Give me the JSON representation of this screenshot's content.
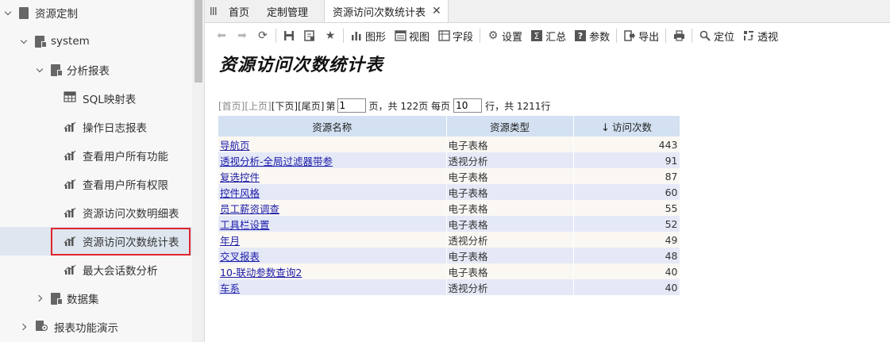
{
  "sidebar": {
    "items": [
      {
        "label": "资源定制"
      },
      {
        "label": "system"
      },
      {
        "label": "分析报表"
      },
      {
        "label": "SQL映射表"
      },
      {
        "label": "操作日志报表"
      },
      {
        "label": "查看用户所有功能"
      },
      {
        "label": "查看用户所有权限"
      },
      {
        "label": "资源访问次数明细表"
      },
      {
        "label": "资源访问次数统计表",
        "selected": true
      },
      {
        "label": "最大会话数分析"
      },
      {
        "label": "数据集"
      },
      {
        "label": "报表功能演示"
      }
    ]
  },
  "tabs": [
    {
      "label": "首页"
    },
    {
      "label": "定制管理"
    },
    {
      "label": "资源访问次数统计表",
      "active": true
    }
  ],
  "toolbar": {
    "chart": "图形",
    "view": "视图",
    "field": "字段",
    "settings": "设置",
    "summary": "汇总",
    "params": "参数",
    "export": "导出",
    "locate": "定位",
    "pivot": "透视"
  },
  "report": {
    "title": "资源访问次数统计表",
    "pager": {
      "first": "[首页]",
      "prev": "[上页]",
      "next": "[下页]",
      "last": "[尾页]",
      "page_prefix": "第",
      "page_value": "1",
      "page_suffix": "页，共 122页 每页",
      "per_page_value": "10",
      "total_suffix": "行，共 1211行"
    },
    "columns": {
      "name": "资源名称",
      "type": "资源类型",
      "count": "访问次数"
    },
    "rows": [
      {
        "name": "导航页",
        "type": "电子表格",
        "count": "443"
      },
      {
        "name": "透视分析-全局过滤器带参",
        "type": "透视分析",
        "count": "91"
      },
      {
        "name": "复选控件",
        "type": "电子表格",
        "count": "87"
      },
      {
        "name": "控件风格",
        "type": "电子表格",
        "count": "60"
      },
      {
        "name": "员工薪资调查",
        "type": "电子表格",
        "count": "55"
      },
      {
        "name": "工具栏设置",
        "type": "电子表格",
        "count": "52"
      },
      {
        "name": "年月",
        "type": "透视分析",
        "count": "49"
      },
      {
        "name": "交叉报表",
        "type": "电子表格",
        "count": "48"
      },
      {
        "name": "10-联动参数查询2",
        "type": "电子表格",
        "count": "40"
      },
      {
        "name": "车系",
        "type": "透视分析",
        "count": "40"
      }
    ]
  },
  "colors": {
    "header_bg": "#d3e1f2",
    "row_odd": "#fbf8f3",
    "row_even": "#e5e9f7",
    "selected_bg": "#dfe6ef",
    "highlight_border": "#e0262f",
    "link": "#1b1ba8"
  }
}
